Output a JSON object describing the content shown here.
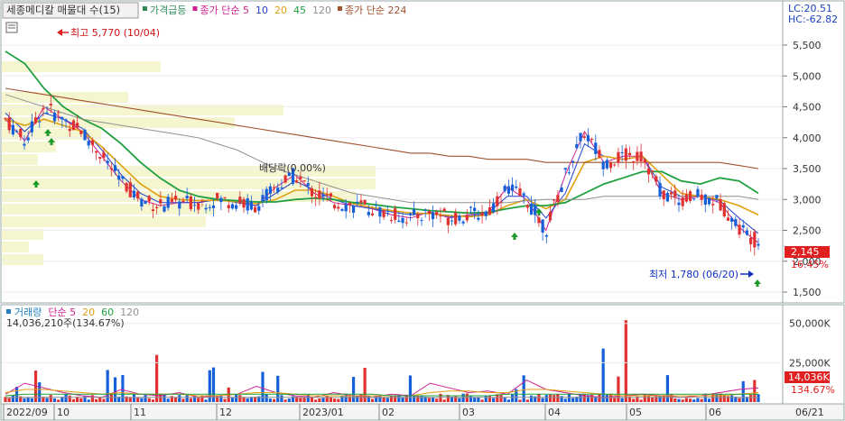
{
  "header": {
    "stock_label": "세종메디칼 매물대 수(15)",
    "indicators": [
      {
        "label": "가격급등",
        "color": "#2e8b57"
      },
      {
        "label": "종가 단순 5",
        "color": "#d02090"
      },
      {
        "label": "10",
        "color": "#2040d0"
      },
      {
        "label": "20",
        "color": "#e0a010"
      },
      {
        "label": "45",
        "color": "#20a040"
      },
      {
        "label": "120",
        "color": "#909090"
      },
      {
        "label": "종가 단순 224",
        "color": "#a0522d"
      }
    ],
    "lc": "LC:20.51",
    "hc": "HC:-62.82"
  },
  "price_axis": {
    "ticks": [
      "5,500",
      "5,000",
      "4,500",
      "4,000",
      "3,500",
      "3,000",
      "2,500",
      "2,000",
      "1,500"
    ],
    "current_price": "2,145",
    "current_pct": "16.45%"
  },
  "annotations": {
    "high": "최고 5,770 (10/04)",
    "low": "최저 1,780 (06/20)",
    "dividend": "배당락(0.00%)"
  },
  "volume": {
    "legend": [
      {
        "label": "거래량",
        "color": "#2080c0"
      },
      {
        "label": "단순 5",
        "color": "#d02090"
      },
      {
        "label": "20",
        "color": "#e0a010"
      },
      {
        "label": "60",
        "color": "#20a040"
      },
      {
        "label": "120",
        "color": "#909090"
      }
    ],
    "summary": "14,036,210주(134.67%)",
    "ticks": [
      "50,000K",
      "25,000K"
    ],
    "current_value": "14,036K",
    "current_pct": "134.67%"
  },
  "time_axis": {
    "labels": [
      "2022/09",
      "10",
      "11",
      "12",
      "2023/01",
      "02",
      "03",
      "04",
      "05",
      "06"
    ],
    "current_date": "06/21"
  },
  "colors": {
    "up": "#e03030",
    "down": "#1560d8",
    "volume_profile": "#f5f5d0",
    "current_price_bg": "#e02020"
  },
  "chart_data": {
    "type": "candlestick",
    "x_range": [
      "2022-09",
      "2023-06-21"
    ],
    "y_range": [
      1500,
      5700
    ],
    "moving_averages": {
      "ma5": [
        4300,
        3950,
        4500,
        4300,
        4100,
        3700,
        3300,
        3000,
        2900,
        2950,
        2950,
        3000,
        2950,
        2900,
        3200,
        3400,
        3100,
        2950,
        2900,
        2850,
        2750,
        2700,
        2800,
        2700,
        2750,
        2800,
        3200,
        3000,
        2500,
        3400,
        4100,
        3600,
        3700,
        3700,
        3100,
        3000,
        3050,
        2950,
        2550,
        2300
      ],
      "ma10": [
        4400,
        4100,
        4400,
        4300,
        4150,
        3800,
        3400,
        3100,
        2950,
        2950,
        2950,
        3000,
        2950,
        2900,
        3100,
        3300,
        3150,
        3000,
        2900,
        2850,
        2800,
        2750,
        2780,
        2720,
        2730,
        2780,
        3050,
        3050,
        2700,
        3100,
        3900,
        3700,
        3650,
        3700,
        3200,
        3050,
        3050,
        2980,
        2700,
        2450
      ],
      "ma20": [
        4300,
        4200,
        4300,
        4200,
        4100,
        3850,
        3550,
        3250,
        3050,
        3000,
        2980,
        2990,
        2960,
        2930,
        3000,
        3150,
        3150,
        3050,
        2930,
        2870,
        2820,
        2780,
        2770,
        2740,
        2720,
        2750,
        2900,
        3000,
        2850,
        3000,
        3600,
        3700,
        3650,
        3700,
        3400,
        3100,
        3050,
        3000,
        2900,
        2750
      ],
      "ma45": [
        5400,
        5200,
        4800,
        4500,
        4300,
        4150,
        3900,
        3600,
        3350,
        3150,
        3050,
        3000,
        2980,
        2960,
        2960,
        3000,
        3020,
        3000,
        2950,
        2920,
        2880,
        2850,
        2820,
        2800,
        2780,
        2790,
        2850,
        2900,
        2900,
        2950,
        3100,
        3250,
        3350,
        3450,
        3450,
        3300,
        3250,
        3350,
        3300,
        3100
      ],
      "ma120": [
        4700,
        4600,
        4500,
        4400,
        4300,
        4250,
        4200,
        4150,
        4100,
        4050,
        4000,
        3900,
        3800,
        3650,
        3500,
        3400,
        3300,
        3200,
        3100,
        3050,
        3000,
        2950,
        2950,
        2950,
        2950,
        2950,
        2950,
        2980,
        3000,
        3000,
        3000,
        3050,
        3050,
        3050,
        3050,
        3050,
        3050,
        3050,
        3050,
        3000
      ],
      "ma224": [
        4800,
        4750,
        4700,
        4650,
        4600,
        4550,
        4500,
        4450,
        4400,
        4350,
        4300,
        4250,
        4200,
        4150,
        4100,
        4050,
        4000,
        3950,
        3900,
        3850,
        3800,
        3750,
        3750,
        3700,
        3700,
        3650,
        3650,
        3650,
        3600,
        3600,
        3600,
        3600,
        3600,
        3600,
        3600,
        3600,
        3600,
        3600,
        3550,
        3500
      ]
    }
  }
}
